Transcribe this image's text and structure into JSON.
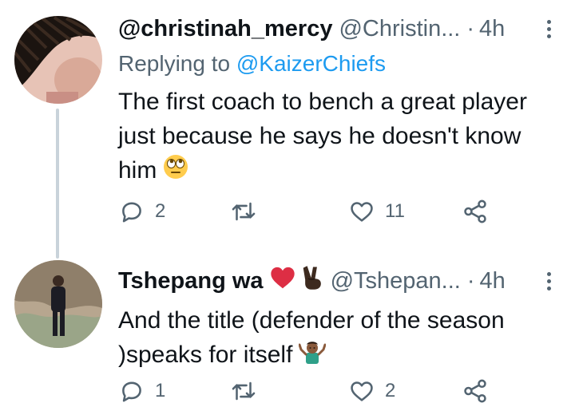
{
  "tweets": [
    {
      "name": "@christinah_mercy",
      "handle": "@Christin...",
      "separator": "·",
      "time": "4h",
      "replying_prefix": "Replying to ",
      "replying_to": "@KaizerChiefs",
      "text": "The first coach to bench a great player just because he says he doesn't know him",
      "emoji": "face-with-rolling-eyes",
      "replies": "2",
      "retweets": "",
      "likes": "11"
    },
    {
      "name": "Tshepang wa",
      "name_emojis": [
        "red-heart",
        "victory-hand"
      ],
      "handle": "@Tshepan...",
      "separator": "·",
      "time": "4h",
      "text": "And the title (defender of the season )speaks for itself",
      "emoji": "man-shrugging",
      "replies": "1",
      "retweets": "",
      "likes": "2"
    }
  ],
  "colors": {
    "text": "#0f1419",
    "muted": "#536471",
    "link": "#1d9bf0",
    "thread_line": "#c9d3da"
  }
}
